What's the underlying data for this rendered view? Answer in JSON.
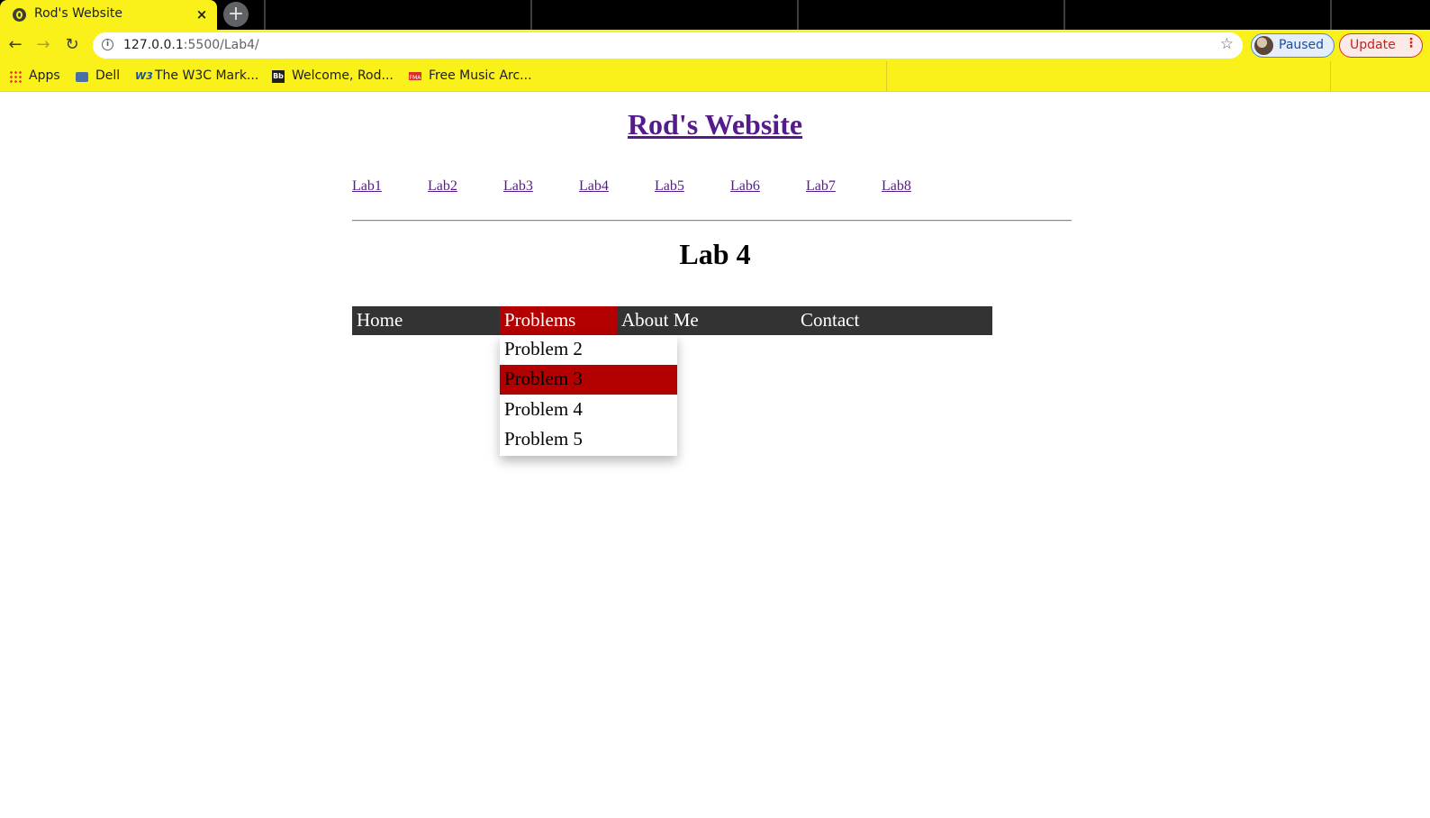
{
  "browser": {
    "tab_title": "Rod's Website",
    "tab_close": "×",
    "new_tab": "+",
    "url_host": "127.0.0.1",
    "url_rest": ":5500/Lab4/",
    "back": "←",
    "forward": "→",
    "reload": "↻",
    "star": "☆",
    "info": "i",
    "profile_label": "Paused",
    "update_label": "Update",
    "update_menu": "⋮",
    "theme_color": "#faf01a"
  },
  "bookmarks": [
    {
      "label": "Apps",
      "icon": "apps-grid-icon"
    },
    {
      "label": "Dell",
      "icon": "folder-icon"
    },
    {
      "label": "The W3C Mark...",
      "icon": "w3c-icon",
      "glyph": "W3"
    },
    {
      "label": "Welcome, Rod...",
      "icon": "blackboard-icon",
      "glyph": "Bb"
    },
    {
      "label": "Free Music Arc...",
      "icon": "fma-icon",
      "glyph": "FMA"
    }
  ],
  "page": {
    "site_title": "Rod's Website",
    "lab_links": [
      "Lab1",
      "Lab2",
      "Lab3",
      "Lab4",
      "Lab5",
      "Lab6",
      "Lab7",
      "Lab8"
    ],
    "heading": "Lab 4",
    "menu": [
      "Home",
      "Problems",
      "About Me",
      "Contact"
    ],
    "active_menu": "Problems",
    "dropdown": [
      "Problem 2",
      "Problem 3",
      "Problem 4",
      "Problem 5"
    ],
    "hovered_item": "Problem 3",
    "accent_color": "#b30000",
    "menubar_color": "#333333",
    "link_color": "#551a8b"
  }
}
